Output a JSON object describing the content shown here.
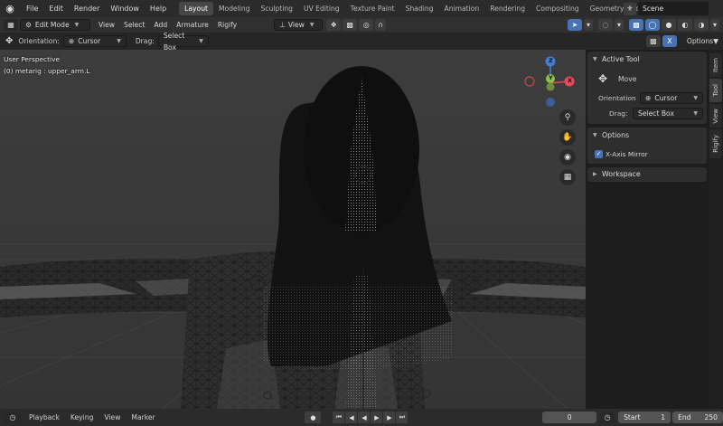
{
  "topbar": {
    "menus": [
      "File",
      "Edit",
      "Render",
      "Window",
      "Help"
    ],
    "workspaces": [
      "Layout",
      "Modeling",
      "Sculpting",
      "UV Editing",
      "Texture Paint",
      "Shading",
      "Animation",
      "Rendering",
      "Compositing",
      "Geometry Noc"
    ],
    "active_workspace": "Layout",
    "scene_name": "Scene"
  },
  "header": {
    "mode": "Edit Mode",
    "menus": [
      "View",
      "Select",
      "Add",
      "Armature",
      "Rigify"
    ],
    "orientation_view": "View",
    "options_label": "Options"
  },
  "toolrow": {
    "orientation_label": "Orientation:",
    "orientation_value": "Cursor",
    "drag_label": "Drag:",
    "drag_value": "Select Box"
  },
  "viewport": {
    "perspective": "User Perspective",
    "object_info": "(0) metarig : upper_arm.L",
    "gizmo": {
      "x": "X",
      "y": "Y",
      "z": "Z"
    }
  },
  "npanel": {
    "active_tool": {
      "title": "Active Tool",
      "tool_name": "Move",
      "orientation_label": "Orientation",
      "orientation_value": "Cursor",
      "drag_label": "Drag:",
      "drag_value": "Select Box"
    },
    "options": {
      "title": "Options",
      "x_axis_mirror_label": "X-Axis Mirror",
      "x_axis_mirror_checked": true
    },
    "workspace_title": "Workspace"
  },
  "tabs": [
    "Item",
    "Tool",
    "View",
    "Rigify"
  ],
  "active_tab": "Tool",
  "bottombar": {
    "menus": [
      "Playback",
      "Keying",
      "View",
      "Marker"
    ],
    "current_frame": "0",
    "start_label": "Start",
    "start_value": "1",
    "end_label": "End",
    "end_value": "250"
  },
  "colors": {
    "accent": "#4772b3",
    "axis_x": "#e54b5a",
    "axis_y": "#8bc34a",
    "axis_z": "#3f7fd8"
  }
}
